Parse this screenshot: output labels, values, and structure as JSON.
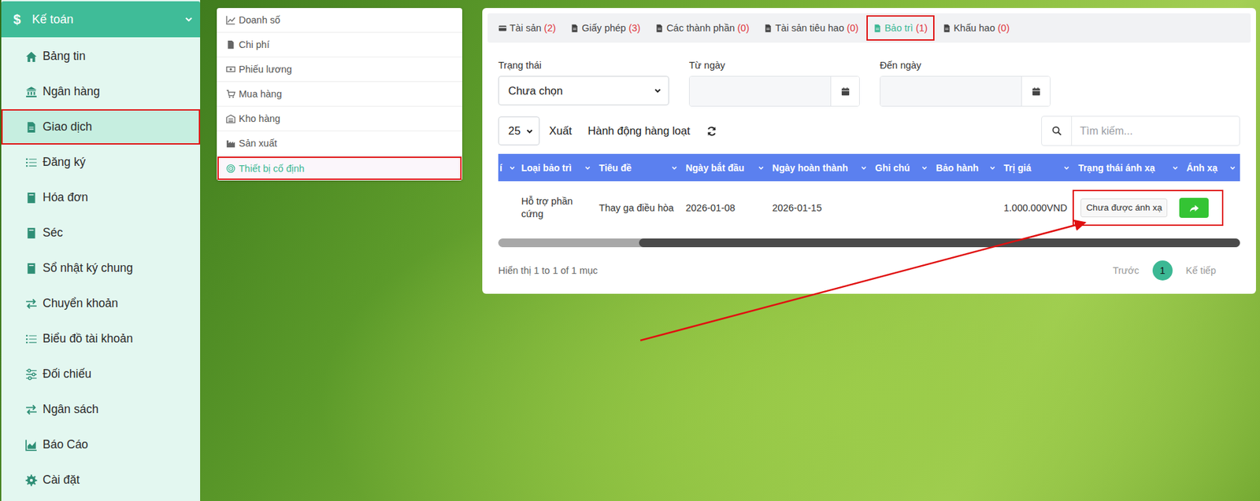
{
  "sidebar": {
    "header": {
      "icon": "$",
      "label": "Kế toán"
    },
    "items": [
      {
        "label": "Bảng tin",
        "selected": false,
        "annotated": false
      },
      {
        "label": "Ngân hàng",
        "selected": false,
        "annotated": false
      },
      {
        "label": "Giao dịch",
        "selected": true,
        "annotated": true
      },
      {
        "label": "Đăng ký",
        "selected": false,
        "annotated": false
      },
      {
        "label": "Hóa đơn",
        "selected": false,
        "annotated": false
      },
      {
        "label": "Séc",
        "selected": false,
        "annotated": false
      },
      {
        "label": "Sổ nhật ký chung",
        "selected": false,
        "annotated": false
      },
      {
        "label": "Chuyển khoản",
        "selected": false,
        "annotated": false
      },
      {
        "label": "Biểu đồ tài khoản",
        "selected": false,
        "annotated": false
      },
      {
        "label": "Đối chiếu",
        "selected": false,
        "annotated": false
      },
      {
        "label": "Ngân sách",
        "selected": false,
        "annotated": false
      },
      {
        "label": "Báo Cáo",
        "selected": false,
        "annotated": false
      },
      {
        "label": "Cài đặt",
        "selected": false,
        "annotated": false
      }
    ]
  },
  "submenu": [
    {
      "label": "Doanh số",
      "selected": false,
      "annotated": false
    },
    {
      "label": "Chi phí",
      "selected": false,
      "annotated": false
    },
    {
      "label": "Phiếu lương",
      "selected": false,
      "annotated": false
    },
    {
      "label": "Mua hàng",
      "selected": false,
      "annotated": false
    },
    {
      "label": "Kho hàng",
      "selected": false,
      "annotated": false
    },
    {
      "label": "Sản xuất",
      "selected": false,
      "annotated": false
    },
    {
      "label": "Thiết bị cố định",
      "selected": true,
      "annotated": true
    }
  ],
  "tabs": [
    {
      "label": "Tài sản",
      "count": "(2)",
      "selected": false,
      "annotated": false
    },
    {
      "label": "Giấy phép",
      "count": "(3)",
      "selected": false,
      "annotated": false
    },
    {
      "label": "Các thành phần",
      "count": "(0)",
      "selected": false,
      "annotated": false
    },
    {
      "label": "Tài sản tiêu hao",
      "count": "(0)",
      "selected": false,
      "annotated": false
    },
    {
      "label": "Bảo trì",
      "count": "(1)",
      "selected": true,
      "annotated": true
    },
    {
      "label": "Khấu hao",
      "count": "(0)",
      "selected": false,
      "annotated": false
    }
  ],
  "filters": [
    {
      "label": "Trạng thái",
      "kind": "select",
      "value": "Chưa chọn"
    },
    {
      "label": "Từ ngày",
      "kind": "date",
      "value": ""
    },
    {
      "label": "Đến ngày",
      "kind": "date",
      "value": ""
    }
  ],
  "toolbar": {
    "page_size": "25",
    "buttons": [
      "Xuất",
      "Hành động hàng loạt"
    ],
    "search_placeholder": "Tìm kiếm..."
  },
  "table": {
    "columns": [
      "í",
      "Loại bảo trì",
      "Tiêu đề",
      "Ngày bắt đầu",
      "Ngày hoàn thành",
      "Ghi chú",
      "Bảo hành",
      "Trị giá",
      "Trạng thái ánh xạ",
      "Ánh xạ"
    ],
    "rows": [
      {
        "cells": [
          "",
          "Hỗ trợ phần cứng",
          "Thay ga điều hòa",
          "2026-01-08",
          "2026-01-15",
          "",
          "",
          "1.000.000VND"
        ],
        "status": "Chưa được ánh xạ",
        "annotated": true
      }
    ],
    "scroll": {
      "thumb_start": 0.19,
      "thumb_size": 0.81
    }
  },
  "footer": {
    "info": "Hiển thị 1 to 1 of 1 mục",
    "prev": "Trước",
    "pages": [
      {
        "label": "1",
        "selected": true
      }
    ],
    "next": "Kế tiếp"
  }
}
